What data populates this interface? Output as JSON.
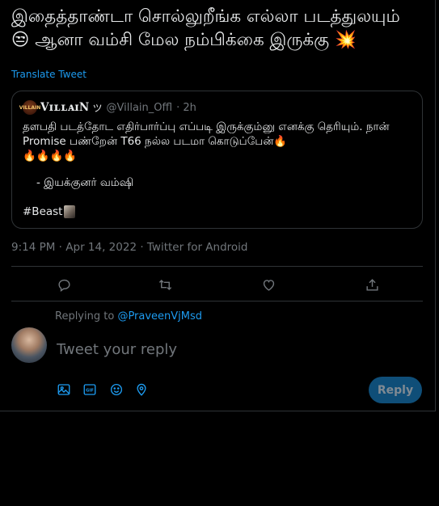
{
  "tweet": {
    "text": "இதைத்தாண்டா சொல்லுறீங்க எல்லா படத்துலயும் 😒 ஆனா வம்சி மேல நம்பிக்கை இருக்கு 💥",
    "translate_label": "Translate Tweet"
  },
  "quote": {
    "avatar_text": "VILLAIN",
    "display_name": "VɪʟʟᴀɪN",
    "badge": "ツ",
    "handle": "@Villain_Offl",
    "age": "· 2h",
    "body": "தளபதி படத்தோட எதிர்பார்ப்பு எப்படி இருக்கும்னு எனக்கு தெரியும். நான் Promise பண்றேன் T66 நல்ல படமா கொடுப்பேன்🔥\n🔥🔥🔥🔥",
    "signature": "- இயக்குனர் வம்ஷி",
    "hashtag": "#Beast"
  },
  "meta": {
    "timestamp": "9:14 PM · Apr 14, 2022 · Twitter for Android"
  },
  "actions": {
    "reply_icon": "reply-icon",
    "retweet_icon": "retweet-icon",
    "like_icon": "heart-icon",
    "share_icon": "share-icon"
  },
  "composer": {
    "replying_prefix": "Replying to",
    "replying_handle": "@PraveenVjMsd",
    "placeholder": "Tweet your reply",
    "value": "",
    "reply_label": "Reply",
    "tools": [
      "image-icon",
      "gif-icon",
      "emoji-icon",
      "location-icon"
    ]
  },
  "colors": {
    "background": "#000000",
    "text": "#e7e9ea",
    "muted": "#71767b",
    "accent": "#1d9bf0",
    "border": "#2f3336",
    "reply_button_disabled": "#0f4e78"
  }
}
